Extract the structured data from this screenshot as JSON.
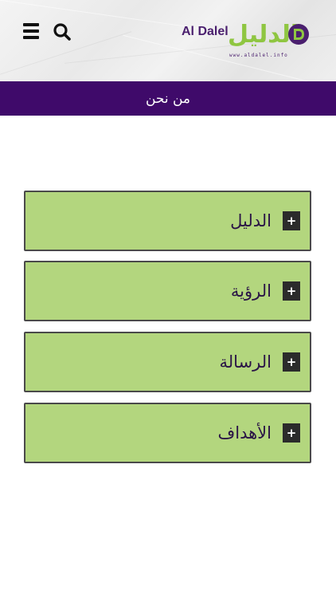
{
  "header": {
    "logo": {
      "latin_text": "Al Dalel",
      "arabic_text": "الدليل",
      "url_text": "www.aldalel.info",
      "colors": {
        "purple": "#4a1f6e",
        "green": "#8fc641"
      }
    },
    "menu_icon": "hamburger-menu-icon",
    "search_icon": "search-icon"
  },
  "title_bar": {
    "title": "من نحن",
    "background": "#3f0a6a"
  },
  "accordion": {
    "panel_color": "#b3d67e",
    "items": [
      {
        "label": "الدليل",
        "toggle": "+"
      },
      {
        "label": "الرؤية",
        "toggle": "+"
      },
      {
        "label": "الرسالة",
        "toggle": "+"
      },
      {
        "label": "الأهداف",
        "toggle": "+"
      }
    ]
  }
}
